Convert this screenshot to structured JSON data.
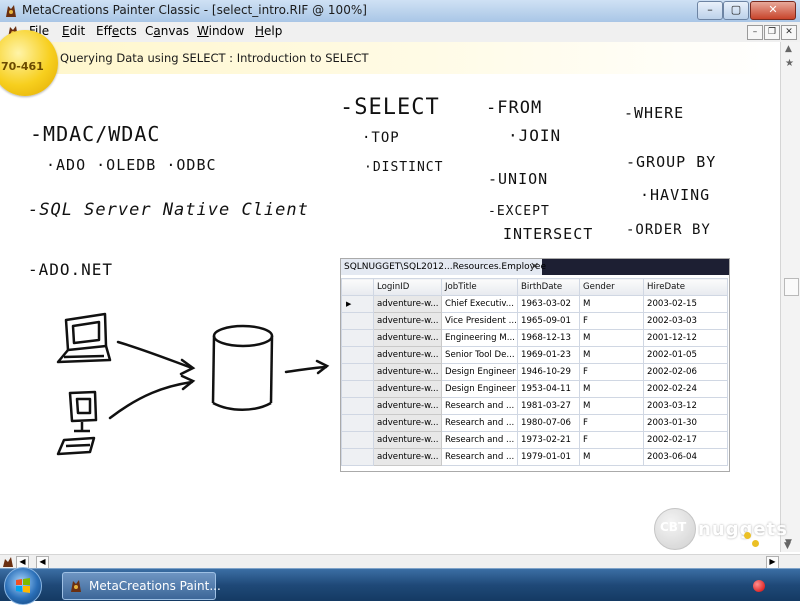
{
  "window": {
    "title": "MetaCreations Painter Classic - [select_intro.RIF @ 100%]"
  },
  "menu": [
    {
      "accel": "F",
      "rest": "ile"
    },
    {
      "accel": "E",
      "rest": "dit"
    },
    {
      "pre": "Eff",
      "accel": "e",
      "rest": "cts"
    },
    {
      "pre": "C",
      "accel": "a",
      "rest": "nvas"
    },
    {
      "accel": "W",
      "rest": "indow"
    },
    {
      "accel": "H",
      "rest": "elp"
    }
  ],
  "banner": {
    "badge": "70-461",
    "topic": "Querying Data using SELECT : Introduction to SELECT"
  },
  "notes": {
    "mdac": "-MDAC/WDAC",
    "ado_stack": "·ADO ·OLEDB ·ODBC",
    "native": "-SQL Server Native Client",
    "adonet": "-ADO.NET",
    "select": "-SELECT",
    "top": "·TOP",
    "distinct": "·DISTINCT",
    "from": "-FROM",
    "join": "·JOIN",
    "union": "-UNION",
    "except": "-EXCEPT",
    "intersect": "INTERSECT",
    "where": "-WHERE",
    "groupby": "-GROUP BY",
    "having": "·HAVING",
    "orderby": "-ORDER BY"
  },
  "grid": {
    "tab_label": "SQLNUGGET\\SQL2012...Resources.Employee",
    "tab_close": "✕",
    "columns": [
      "LoginID",
      "JobTitle",
      "BirthDate",
      "Gender",
      "HireDate"
    ],
    "rows": [
      [
        "adventure-w...",
        "Chief Executiv...",
        "1963-03-02",
        "M",
        "2003-02-15"
      ],
      [
        "adventure-w...",
        "Vice President ...",
        "1965-09-01",
        "F",
        "2002-03-03"
      ],
      [
        "adventure-w...",
        "Engineering M...",
        "1968-12-13",
        "M",
        "2001-12-12"
      ],
      [
        "adventure-w...",
        "Senior Tool De...",
        "1969-01-23",
        "M",
        "2002-01-05"
      ],
      [
        "adventure-w...",
        "Design Engineer",
        "1946-10-29",
        "F",
        "2002-02-06"
      ],
      [
        "adventure-w...",
        "Design Engineer",
        "1953-04-11",
        "M",
        "2002-02-24"
      ],
      [
        "adventure-w...",
        "Research and ...",
        "1981-03-27",
        "M",
        "2003-03-12"
      ],
      [
        "adventure-w...",
        "Research and ...",
        "1980-07-06",
        "F",
        "2003-01-30"
      ],
      [
        "adventure-w...",
        "Research and ...",
        "1973-02-21",
        "F",
        "2002-02-17"
      ],
      [
        "adventure-w...",
        "Research and ...",
        "1979-01-01",
        "M",
        "2003-06-04"
      ]
    ]
  },
  "taskbar": {
    "app_label": "MetaCreations Paint..."
  },
  "logo": {
    "part1": "CBT",
    "part2": "nuggets"
  },
  "colors": {
    "banner": "#fff6c9",
    "badge": "#f7cf1e",
    "taskbar": "#1f4978",
    "tab_strip": "#1d1f33"
  }
}
